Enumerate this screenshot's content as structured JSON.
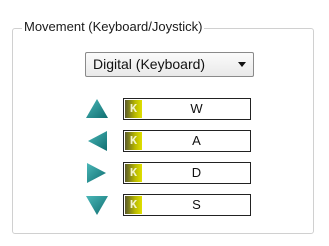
{
  "group": {
    "title": "Movement (Keyboard/Joystick)"
  },
  "mode_select": {
    "value": "Digital (Keyboard)"
  },
  "bindings": [
    {
      "direction": "up",
      "badge": "K",
      "key": "W",
      "icon": "arrow-up-icon"
    },
    {
      "direction": "left",
      "badge": "K",
      "key": "A",
      "icon": "arrow-left-icon"
    },
    {
      "direction": "right",
      "badge": "K",
      "key": "D",
      "icon": "arrow-right-icon"
    },
    {
      "direction": "down",
      "badge": "K",
      "key": "S",
      "icon": "arrow-down-icon"
    }
  ],
  "colors": {
    "arrow": "#1b8a8c",
    "badge": "#b8b800"
  }
}
